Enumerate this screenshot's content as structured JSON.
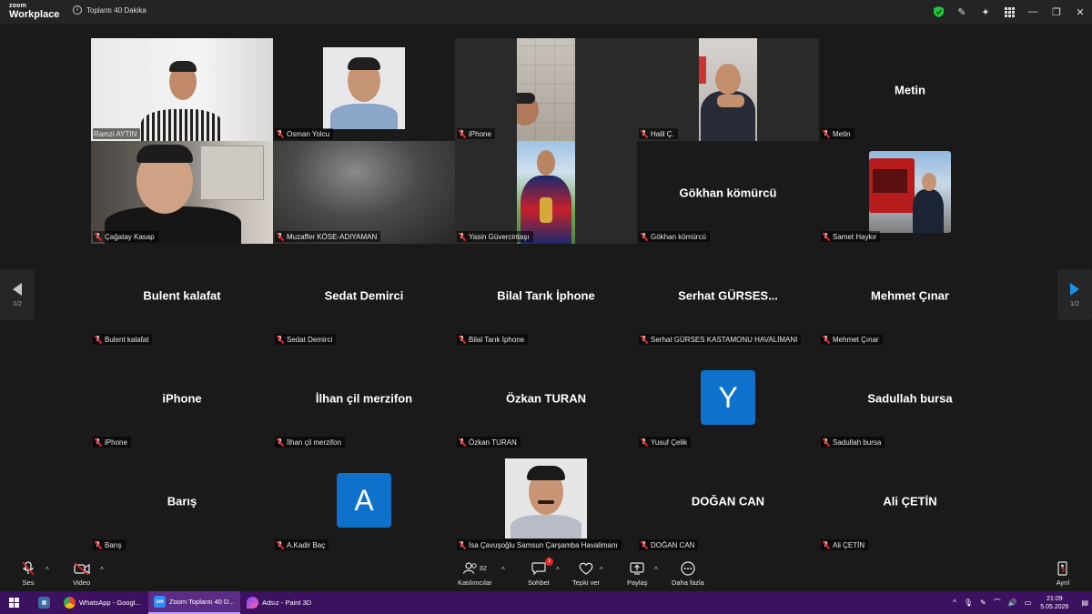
{
  "titlebar": {
    "brand_line1": "zoom",
    "brand_line2": "Workplace",
    "meeting_title": "Toplantı 40 Dakika"
  },
  "tiles": [
    {
      "label": "Ramzi AYTİN",
      "display": ""
    },
    {
      "label": "Osman Yolcu",
      "display": ""
    },
    {
      "label": "iPhone",
      "display": ""
    },
    {
      "label": "Halil Ç.",
      "display": ""
    },
    {
      "label": "Metin",
      "display": "Metin"
    },
    {
      "label": "Çağatay Kasap",
      "display": ""
    },
    {
      "label": "Muzaffer KÖSE-ADIYAMAN",
      "display": ""
    },
    {
      "label": "Yasin Güvercintaşı",
      "display": ""
    },
    {
      "label": "Gökhan  kömürcü",
      "display": "Gökhan  kömürcü"
    },
    {
      "label": "Samet Haykır",
      "display": ""
    },
    {
      "label": "Bulent kalafat",
      "display": "Bulent kalafat"
    },
    {
      "label": "Sedat Demirci",
      "display": "Sedat Demirci"
    },
    {
      "label": "Bilal Tarık İphone",
      "display": "Bilal Tarık İphone"
    },
    {
      "label": "Serhat GÜRSES KASTAMONU HAVALİMANI",
      "display": "Serhat  GÜRSES..."
    },
    {
      "label": "Mehmet Çınar",
      "display": "Mehmet Çınar"
    },
    {
      "label": "iPhone",
      "display": "iPhone"
    },
    {
      "label": "İlhan çil merzifon",
      "display": "İlhan çil merzifon"
    },
    {
      "label": "Özkan TURAN",
      "display": "Özkan TURAN"
    },
    {
      "label": "Yusuf Çelik",
      "display": "",
      "avatar": "Y"
    },
    {
      "label": "Sadullah bursa",
      "display": "Sadullah bursa"
    },
    {
      "label": "Barış",
      "display": "Barış"
    },
    {
      "label": "A.Kadir Baç",
      "display": "",
      "avatar": "A"
    },
    {
      "label": "İsa Çavuşoğlu Samsun Çarşamba Havalimanı",
      "display": ""
    },
    {
      "label": "DOĞAN CAN",
      "display": "DOĞAN CAN"
    },
    {
      "label": "Ali ÇETİN",
      "display": "Ali ÇETİN"
    }
  ],
  "pager": {
    "left": "1/2",
    "right": "1/2"
  },
  "toolbar": {
    "audio": "Ses",
    "video": "Video",
    "participants": "Katılımcılar",
    "participants_count": "32",
    "chat": "Sohbet",
    "chat_badge": "1",
    "reactions": "Tepki ver",
    "share": "Paylaş",
    "more": "Daha fazla",
    "leave": "Ayrıl"
  },
  "taskbar": {
    "apps": [
      "WhatsApp - Googl...",
      "Zoom Toplantı 40 D...",
      "Adsız - Paint 3D"
    ],
    "time": "21:09",
    "date": "5.05.2026"
  }
}
